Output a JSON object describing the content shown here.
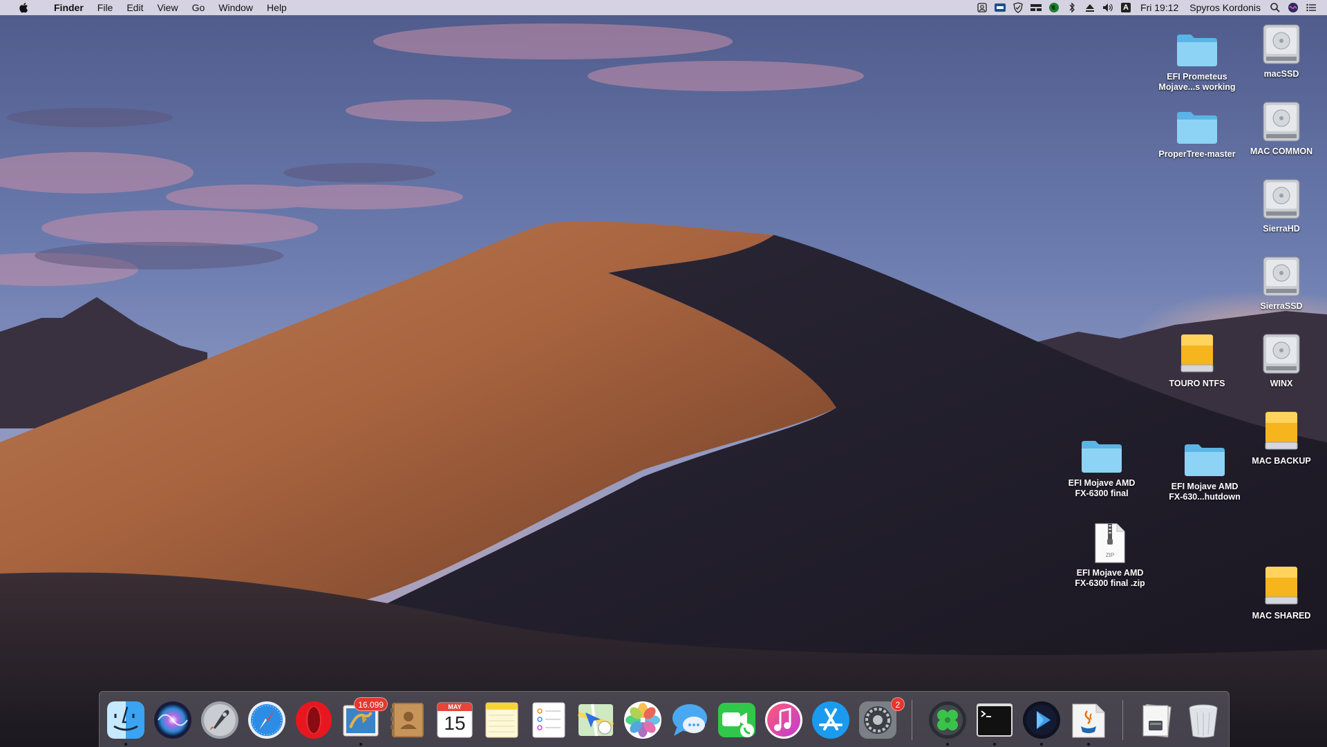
{
  "menubar": {
    "app_name": "Finder",
    "menus": [
      "File",
      "Edit",
      "View",
      "Go",
      "Window",
      "Help"
    ],
    "clock": "Fri 19:12",
    "user": "Spyros Kordonis",
    "input_source": "A",
    "status_icons": [
      "display-icon",
      "drive-icon",
      "shield-icon",
      "dashboard-icon",
      "globe-icon",
      "bluetooth-icon",
      "eject-icon",
      "volume-icon",
      "input-source-icon",
      "spotlight-icon",
      "siri-icon",
      "notification-center-icon"
    ]
  },
  "desktop": {
    "icons": [
      {
        "label": "EFI Prometeus Mojave...s working",
        "type": "folder"
      },
      {
        "label": "macSSD",
        "type": "hard-drive"
      },
      {
        "label": "ProperTree-master",
        "type": "folder"
      },
      {
        "label": "MAC COMMON",
        "type": "hard-drive"
      },
      {
        "label": "SierraHD",
        "type": "hard-drive"
      },
      {
        "label": "SierraSSD",
        "type": "hard-drive"
      },
      {
        "label": "TOURO NTFS",
        "type": "external-drive"
      },
      {
        "label": "WINX",
        "type": "hard-drive"
      },
      {
        "label": "MAC BACKUP",
        "type": "external-drive"
      },
      {
        "label": "EFI Mojave AMD FX-6300 final",
        "type": "folder"
      },
      {
        "label": "EFI Mojave AMD FX-630...hutdown",
        "type": "folder"
      },
      {
        "label": "EFI Mojave AMD FX-6300 final .zip",
        "type": "zip"
      },
      {
        "label": "MAC SHARED",
        "type": "external-drive"
      }
    ],
    "zip_badge": "ZIP"
  },
  "dock": {
    "apps": [
      {
        "name": "finder-icon",
        "running": true
      },
      {
        "name": "siri-icon",
        "running": false
      },
      {
        "name": "launchpad-icon",
        "running": false
      },
      {
        "name": "safari-icon",
        "running": false
      },
      {
        "name": "opera-icon",
        "running": false
      },
      {
        "name": "mail-icon",
        "running": true,
        "badge": "16.099"
      },
      {
        "name": "contacts-icon",
        "running": false
      },
      {
        "name": "calendar-icon",
        "running": false,
        "month": "MAY",
        "day": "15"
      },
      {
        "name": "notes-icon",
        "running": false
      },
      {
        "name": "reminders-icon",
        "running": false
      },
      {
        "name": "maps-icon",
        "running": false
      },
      {
        "name": "photos-icon",
        "running": false
      },
      {
        "name": "messages-icon",
        "running": false
      },
      {
        "name": "facetime-icon",
        "running": false
      },
      {
        "name": "itunes-icon",
        "running": false
      },
      {
        "name": "app-store-icon",
        "running": false
      },
      {
        "name": "system-preferences-icon",
        "running": false,
        "badge": "2"
      },
      {
        "name": "clover-configurator-icon",
        "running": true
      },
      {
        "name": "terminal-icon",
        "running": true
      },
      {
        "name": "media-player-icon",
        "running": true
      },
      {
        "name": "java-icon",
        "running": true
      },
      {
        "name": "downloads-stack-icon",
        "running": false
      },
      {
        "name": "trash-icon",
        "running": false
      }
    ]
  },
  "colors": {
    "folder": "#6ec6f1",
    "badge": "#e5362f",
    "menubar": "#e8e4ee"
  }
}
